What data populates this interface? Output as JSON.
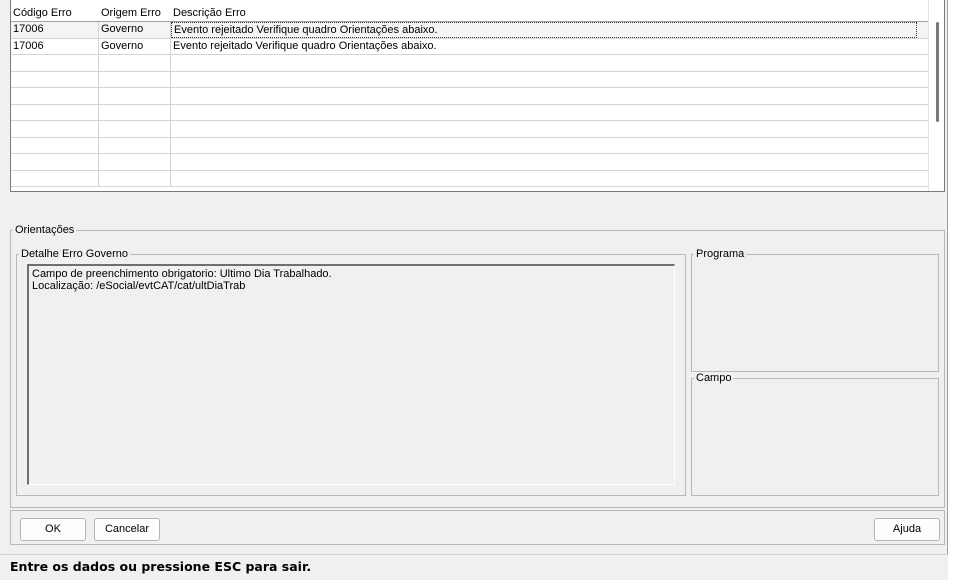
{
  "grid": {
    "columns": [
      "Código Erro",
      "Origem Erro",
      "Descrição Erro"
    ],
    "rows": [
      {
        "code": "17006",
        "origin": "Governo",
        "description": "Evento rejeitado Verifique quadro Orientações abaixo."
      },
      {
        "code": "17006",
        "origin": "Governo",
        "description": "Evento rejeitado Verifique quadro Orientações abaixo."
      }
    ]
  },
  "orientacoes": {
    "legend": "Orientações",
    "detalhe_legend": "Detalhe Erro Governo",
    "detalhe_lines": [
      "Campo de preenchimento obrigatorio: Ultimo Dia Trabalhado.",
      "Localização: /eSocial/evtCAT/cat/ultDiaTrab"
    ],
    "programa_legend": "Programa",
    "campo_legend": "Campo"
  },
  "buttons": {
    "ok": "OK",
    "cancel": "Cancelar",
    "help": "Ajuda"
  },
  "status_text": "Entre os dados ou pressione ESC para sair."
}
